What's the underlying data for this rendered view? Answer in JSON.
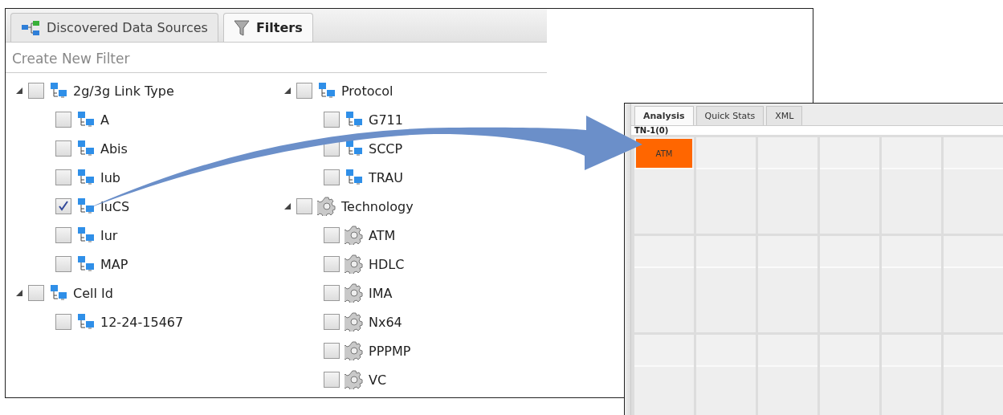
{
  "filters_window": {
    "tabs": [
      {
        "label": "Discovered Data Sources",
        "kind": "sources",
        "selected": false
      },
      {
        "label": "Filters",
        "kind": "funnel",
        "selected": true
      }
    ],
    "search": {
      "placeholder": "Create New Filter"
    },
    "tree_columns": [
      {
        "groups": [
          {
            "label": "2g/3g Link Type",
            "kind": "network",
            "expanded": true,
            "checked": false,
            "children": [
              {
                "label": "A",
                "kind": "network",
                "checked": false
              },
              {
                "label": "Abis",
                "kind": "network",
                "checked": false
              },
              {
                "label": "Iub",
                "kind": "network",
                "checked": false
              },
              {
                "label": "IuCS",
                "kind": "network",
                "checked": true
              },
              {
                "label": "Iur",
                "kind": "network",
                "checked": false
              },
              {
                "label": "MAP",
                "kind": "network",
                "checked": false
              }
            ]
          },
          {
            "label": "Cell Id",
            "kind": "network",
            "expanded": true,
            "checked": false,
            "children": [
              {
                "label": "12-24-15467",
                "kind": "network",
                "checked": false
              }
            ]
          }
        ]
      },
      {
        "groups": [
          {
            "label": "Protocol",
            "kind": "network",
            "expanded": true,
            "checked": false,
            "children": [
              {
                "label": "G711",
                "kind": "network",
                "checked": false
              },
              {
                "label": "SCCP",
                "kind": "network",
                "checked": false
              },
              {
                "label": "TRAU",
                "kind": "network",
                "checked": false
              }
            ]
          },
          {
            "label": "Technology",
            "kind": "gear",
            "expanded": true,
            "checked": false,
            "children": [
              {
                "label": "ATM",
                "kind": "gear",
                "checked": false
              },
              {
                "label": "HDLC",
                "kind": "gear",
                "checked": false
              },
              {
                "label": "IMA",
                "kind": "gear",
                "checked": false
              },
              {
                "label": "Nx64",
                "kind": "gear",
                "checked": false
              },
              {
                "label": "PPPMP",
                "kind": "gear",
                "checked": false
              },
              {
                "label": "VC",
                "kind": "gear",
                "checked": false
              }
            ]
          }
        ]
      }
    ]
  },
  "analysis_window": {
    "tabs": [
      {
        "label": "Analysis",
        "selected": true
      },
      {
        "label": "Quick Stats",
        "selected": false
      },
      {
        "label": "XML",
        "selected": false
      }
    ],
    "path_label": "TN-1(0)",
    "cells": [
      {
        "label": "ATM",
        "color": "#ff6600"
      }
    ]
  }
}
